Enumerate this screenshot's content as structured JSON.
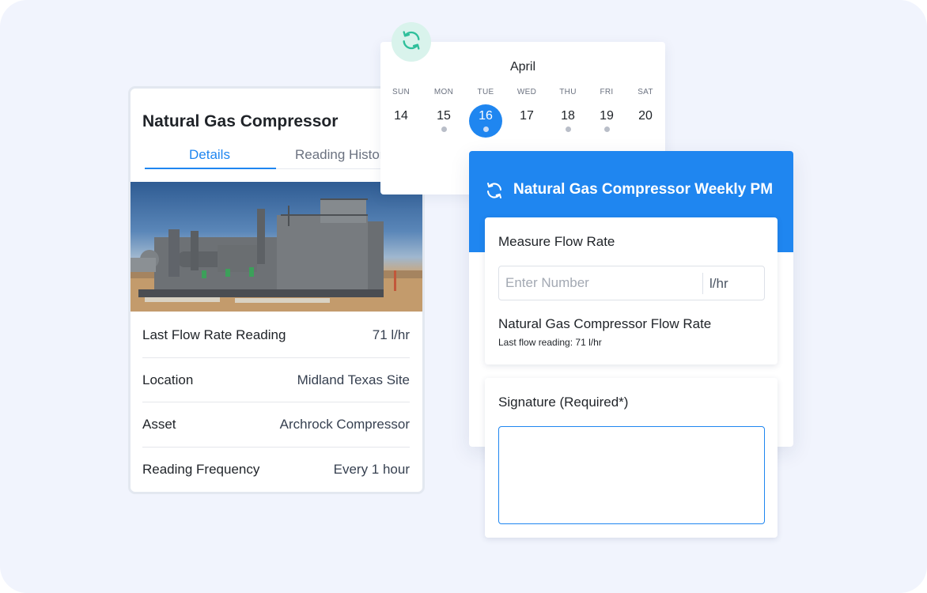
{
  "asset": {
    "title": "Natural Gas Compressor",
    "tabs": [
      {
        "label": "Details",
        "active": true
      },
      {
        "label": "Reading History",
        "active": false
      }
    ],
    "details": [
      {
        "label": "Last Flow Rate Reading",
        "value": "71 l/hr"
      },
      {
        "label": "Location",
        "value": "Midland Texas Site"
      },
      {
        "label": "Asset",
        "value": "Archrock Compressor"
      },
      {
        "label": "Reading Frequency",
        "value": "Every 1 hour"
      }
    ]
  },
  "calendar": {
    "month": "April",
    "days": [
      {
        "dow": "SUN",
        "date": "14",
        "selected": false,
        "has_event": false
      },
      {
        "dow": "MON",
        "date": "15",
        "selected": false,
        "has_event": true
      },
      {
        "dow": "TUE",
        "date": "16",
        "selected": true,
        "has_event": true
      },
      {
        "dow": "WED",
        "date": "17",
        "selected": false,
        "has_event": false
      },
      {
        "dow": "THU",
        "date": "18",
        "selected": false,
        "has_event": true
      },
      {
        "dow": "FRI",
        "date": "19",
        "selected": false,
        "has_event": true
      },
      {
        "dow": "SAT",
        "date": "20",
        "selected": false,
        "has_event": false
      }
    ]
  },
  "work_order": {
    "title": "Natural Gas Compressor Weekly PM",
    "icon": "sync-icon",
    "flow": {
      "label": "Measure Flow Rate",
      "placeholder": "Enter Number",
      "value": "",
      "unit": "l/hr",
      "meter_title": "Natural Gas Compressor Flow Rate",
      "meter_note": "Last flow reading: 71 l/hr"
    },
    "signature": {
      "label": "Signature (Required*)"
    }
  },
  "colors": {
    "accent": "#1f86f0",
    "background": "#f1f4fd",
    "sync_badge_bg": "#d9f3ec",
    "sync_badge_fg": "#2fbf9b"
  }
}
